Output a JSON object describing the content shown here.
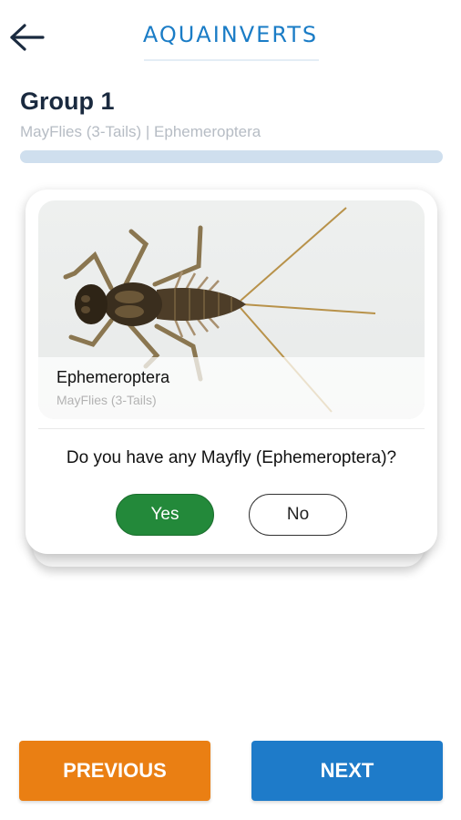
{
  "header": {
    "app_title": "AQUAINVERTS",
    "back_icon": "arrow-left-icon"
  },
  "group": {
    "title": "Group 1",
    "subtitle": "MayFlies (3-Tails) | Ephemeroptera",
    "progress_fraction": 0.0
  },
  "card": {
    "image_subject": "mayfly-nymph",
    "caption_title": "Ephemeroptera",
    "caption_subtitle": "MayFlies (3-Tails)",
    "question": "Do you have any Mayfly (Ephemeroptera)?",
    "yes_label": "Yes",
    "no_label": "No"
  },
  "nav": {
    "previous_label": "PREVIOUS",
    "next_label": "NEXT"
  },
  "colors": {
    "brand_blue": "#1a7cc6",
    "yes_green": "#23893a",
    "previous_orange": "#ea7f13",
    "next_blue": "#1e7bc9"
  }
}
